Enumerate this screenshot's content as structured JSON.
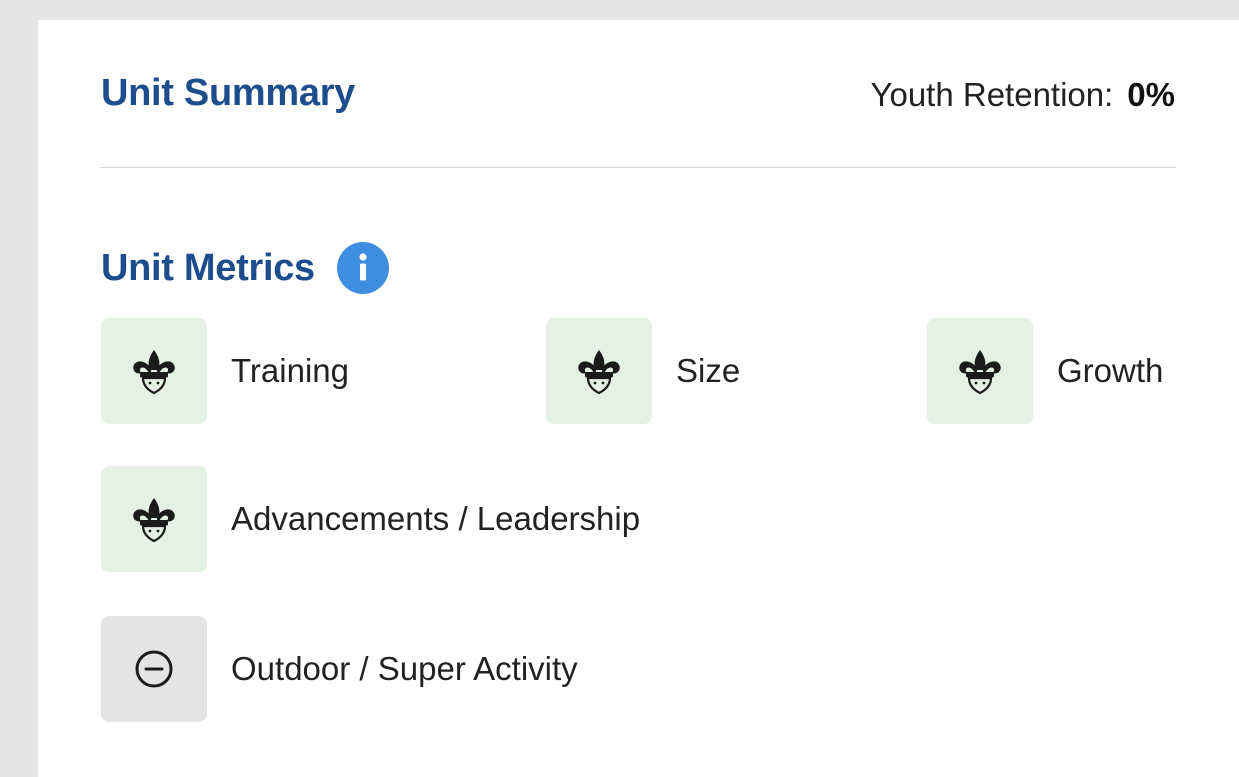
{
  "summary": {
    "title": "Unit Summary",
    "retention_label": "Youth Retention:",
    "retention_value": "0%"
  },
  "metrics": {
    "title": "Unit Metrics",
    "info_icon": "info-icon",
    "items": [
      {
        "label": "Training",
        "status": "met",
        "icon": "fleur-de-lis-icon"
      },
      {
        "label": "Size",
        "status": "met",
        "icon": "fleur-de-lis-icon"
      },
      {
        "label": "Growth",
        "status": "met",
        "icon": "fleur-de-lis-icon"
      },
      {
        "label": "Advancements / Leadership",
        "status": "met",
        "icon": "fleur-de-lis-icon"
      },
      {
        "label": "Outdoor / Super Activity",
        "status": "not-met",
        "icon": "minus-circle-icon"
      }
    ]
  },
  "colors": {
    "heading": "#1d4d8c",
    "info_icon": "#3f8fe0",
    "met_tile": "#e3f2e3",
    "not_met_tile": "#e4e4e4"
  }
}
